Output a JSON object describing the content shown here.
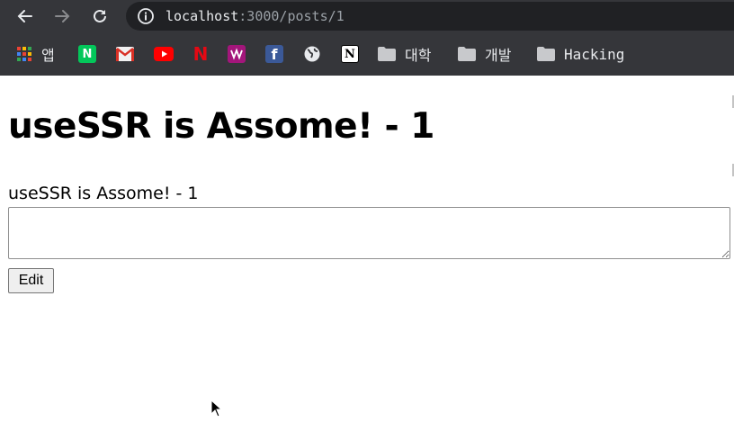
{
  "browser": {
    "url_host": "localhost",
    "url_path": ":3000/posts/1",
    "bookmarks": [
      {
        "label": "앱",
        "icon": "apps-grid-icon"
      },
      {
        "label": "",
        "icon": "naver-icon"
      },
      {
        "label": "",
        "icon": "gmail-icon"
      },
      {
        "label": "",
        "icon": "youtube-icon"
      },
      {
        "label": "",
        "icon": "netflix-icon"
      },
      {
        "label": "",
        "icon": "music-icon"
      },
      {
        "label": "",
        "icon": "facebook-icon"
      },
      {
        "label": "",
        "icon": "globe-icon"
      },
      {
        "label": "",
        "icon": "notion-icon"
      },
      {
        "label": "대학",
        "icon": "folder-icon"
      },
      {
        "label": "개발",
        "icon": "folder-icon"
      },
      {
        "label": "Hacking",
        "icon": "folder-icon"
      }
    ],
    "favicon_letters": {
      "naver": "N",
      "facebook": "f",
      "notion": "N",
      "netflix": "N"
    }
  },
  "post": {
    "title": "useSSR is Assome! - 1",
    "body": "useSSR is Assome! - 1",
    "textarea_value": "",
    "edit_label": "Edit"
  },
  "colors": {
    "chrome_bg": "#35363a",
    "omnibox_bg": "#202124",
    "chrome_text": "#e8eaed"
  }
}
